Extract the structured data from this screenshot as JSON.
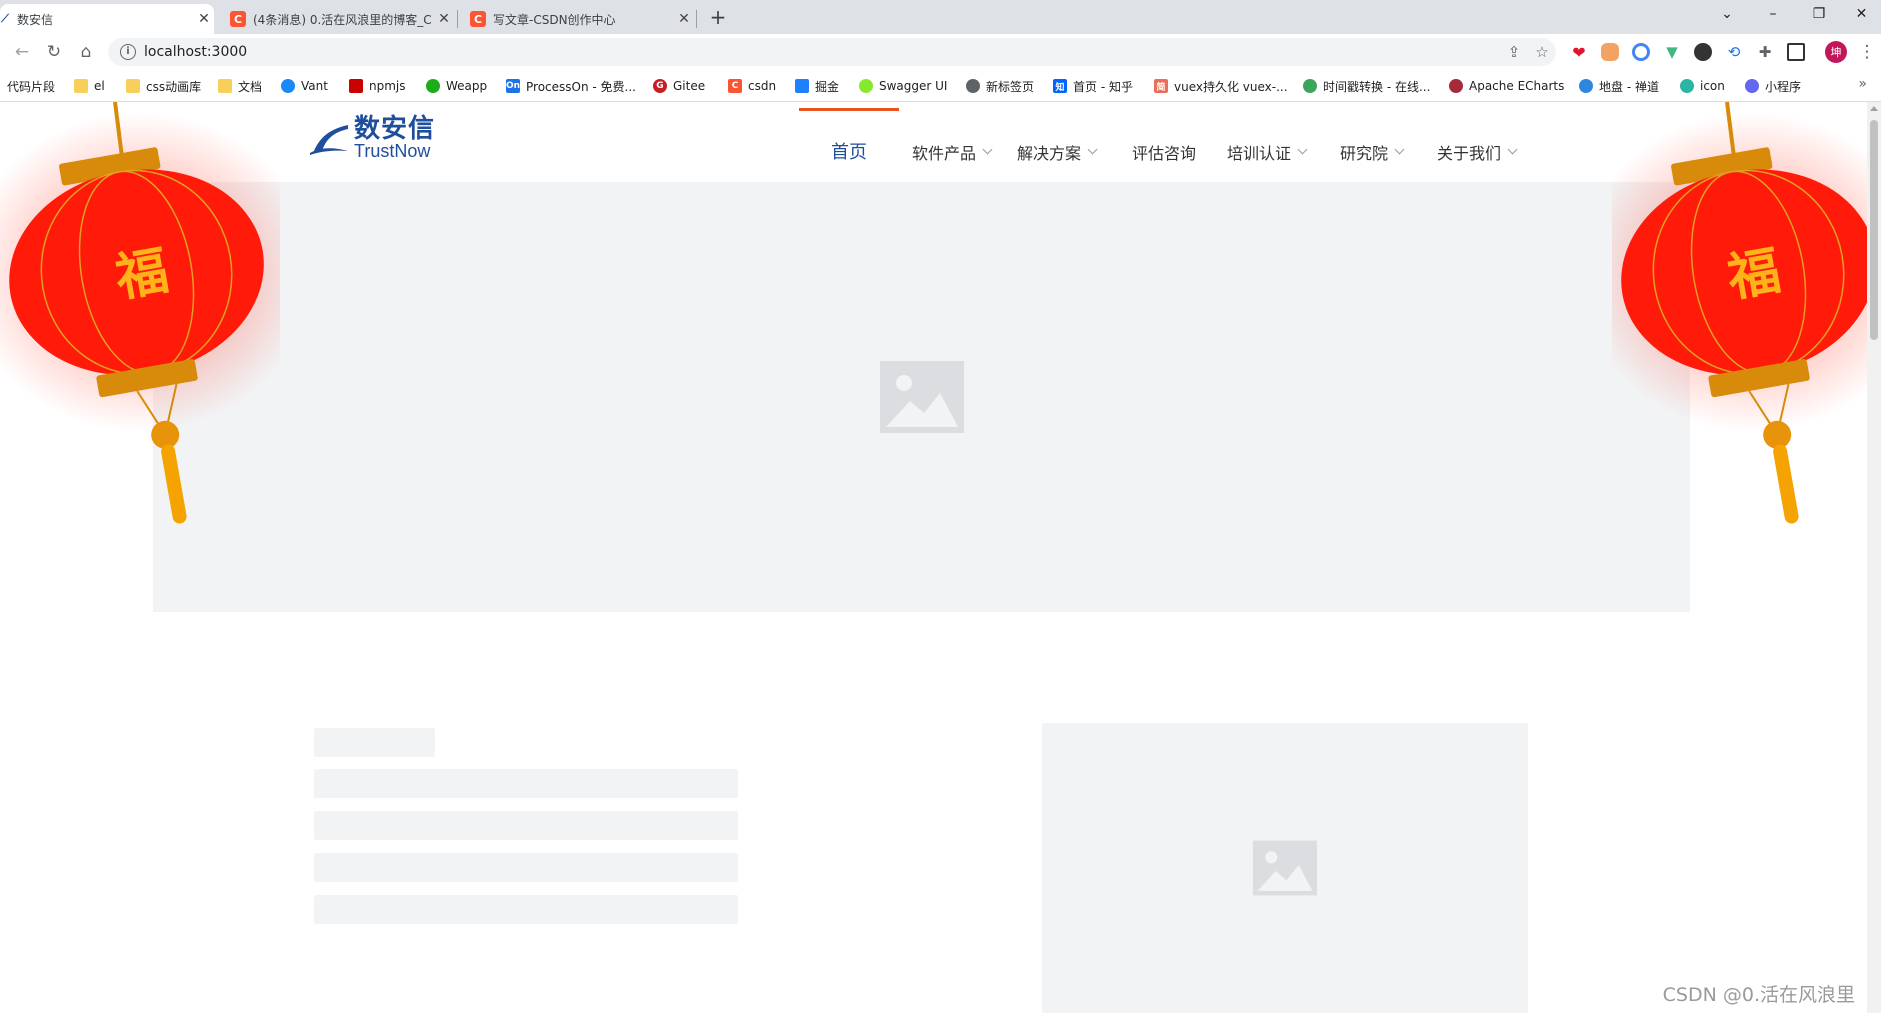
{
  "browser": {
    "tabs": [
      {
        "title": "数安信",
        "favicon": "trustnow",
        "active": true
      },
      {
        "title": "(4条消息) 0.活在风浪里的博客_C",
        "favicon": "C",
        "active": false
      },
      {
        "title": "写文章-CSDN创作中心",
        "favicon": "C",
        "active": false
      }
    ],
    "new_tab": "+",
    "url": "localhost:3000",
    "window_controls": {
      "dropdown": "⌄",
      "minimize": "–",
      "restore": "❐",
      "close": "✕"
    },
    "bookmarks": [
      {
        "label": "代码片段",
        "icon": "none"
      },
      {
        "label": "el",
        "icon": "folder-icon"
      },
      {
        "label": "css动画库",
        "icon": "folder-icon"
      },
      {
        "label": "文档",
        "icon": "folder-icon"
      },
      {
        "label": "Vant",
        "icon": "vant-icon"
      },
      {
        "label": "npmjs",
        "icon": "npm-icon"
      },
      {
        "label": "Weapp",
        "icon": "weapp-icon"
      },
      {
        "label": "ProcessOn - 免费...",
        "icon": "processon-icon"
      },
      {
        "label": "Gitee",
        "icon": "gitee-icon"
      },
      {
        "label": "csdn",
        "icon": "csdn-icon"
      },
      {
        "label": "掘金",
        "icon": "juejin-icon"
      },
      {
        "label": "Swagger UI",
        "icon": "swagger-icon"
      },
      {
        "label": "新标签页",
        "icon": "newtab-icon"
      },
      {
        "label": "首页 - 知乎",
        "icon": "zhihu-icon"
      },
      {
        "label": "vuex持久化 vuex-...",
        "icon": "jianshu-icon"
      },
      {
        "label": "时间戳转换 - 在线...",
        "icon": "tool-icon"
      },
      {
        "label": "Apache ECharts",
        "icon": "echarts-icon"
      },
      {
        "label": "地盘 - 禅道",
        "icon": "zentao-icon"
      },
      {
        "label": "icon",
        "icon": "iconfont-icon"
      },
      {
        "label": "小程序",
        "icon": "miniapp-icon"
      }
    ],
    "bookmarks_more": "»",
    "profile_initial": "坤"
  },
  "site": {
    "logo": {
      "cn": "数安信",
      "en": "TrustNow"
    },
    "nav": [
      {
        "label": "首页",
        "active": true,
        "dropdown": false
      },
      {
        "label": "软件产品",
        "active": false,
        "dropdown": true
      },
      {
        "label": "解决方案",
        "active": false,
        "dropdown": true
      },
      {
        "label": "评估咨询",
        "active": false,
        "dropdown": false
      },
      {
        "label": "培训认证",
        "active": false,
        "dropdown": true
      },
      {
        "label": "研究院",
        "active": false,
        "dropdown": true
      },
      {
        "label": "关于我们",
        "active": false,
        "dropdown": true
      }
    ],
    "lantern_char": "福",
    "watermark": "CSDN @0.活在风浪里"
  },
  "colors": {
    "brand": "#1f4e9c",
    "active_indicator": "#e8541e",
    "skeleton": "#f2f3f5",
    "lantern_red": "#ff1a0a",
    "lantern_gold": "#d88a0a"
  }
}
